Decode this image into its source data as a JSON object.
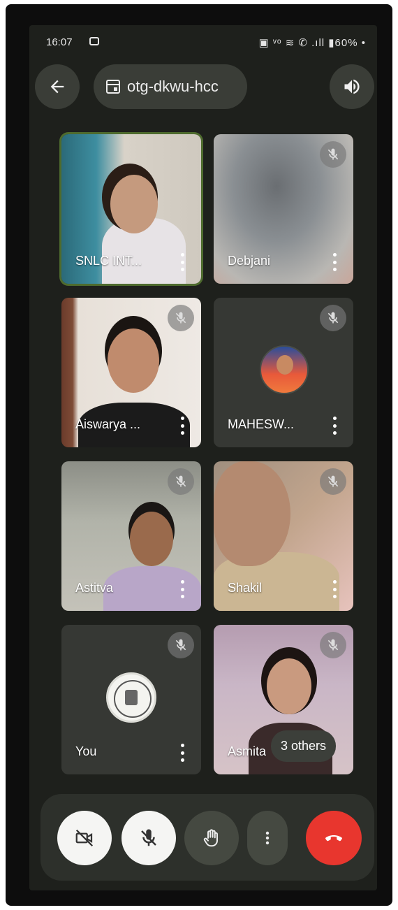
{
  "status_bar": {
    "time": "16:07",
    "right_icons": "▣ ᵛᵒ ≋ ✆ .ıll ▮60% •"
  },
  "top_bar": {
    "meeting_code": "otg-dkwu-hcc",
    "back_icon": "arrow-left-icon",
    "calendar_icon": "calendar-icon",
    "sound_icon": "speaker-icon"
  },
  "participants": [
    {
      "name": "SNLC INT...",
      "muted": false,
      "active": true
    },
    {
      "name": "Debjani",
      "muted": true
    },
    {
      "name": "Aiswarya ...",
      "muted": true
    },
    {
      "name": "MAHESW...",
      "muted": true
    },
    {
      "name": "Astitva",
      "muted": true
    },
    {
      "name": "Shakil",
      "muted": true
    },
    {
      "name": "You",
      "muted": true
    },
    {
      "name": "Asmita",
      "muted": true
    }
  ],
  "others_chip": "3 others",
  "controls": {
    "camera": "camera-off-icon",
    "mic": "mic-off-icon",
    "hand": "raise-hand-icon",
    "more": "more-vert-icon",
    "end": "end-call-icon"
  }
}
